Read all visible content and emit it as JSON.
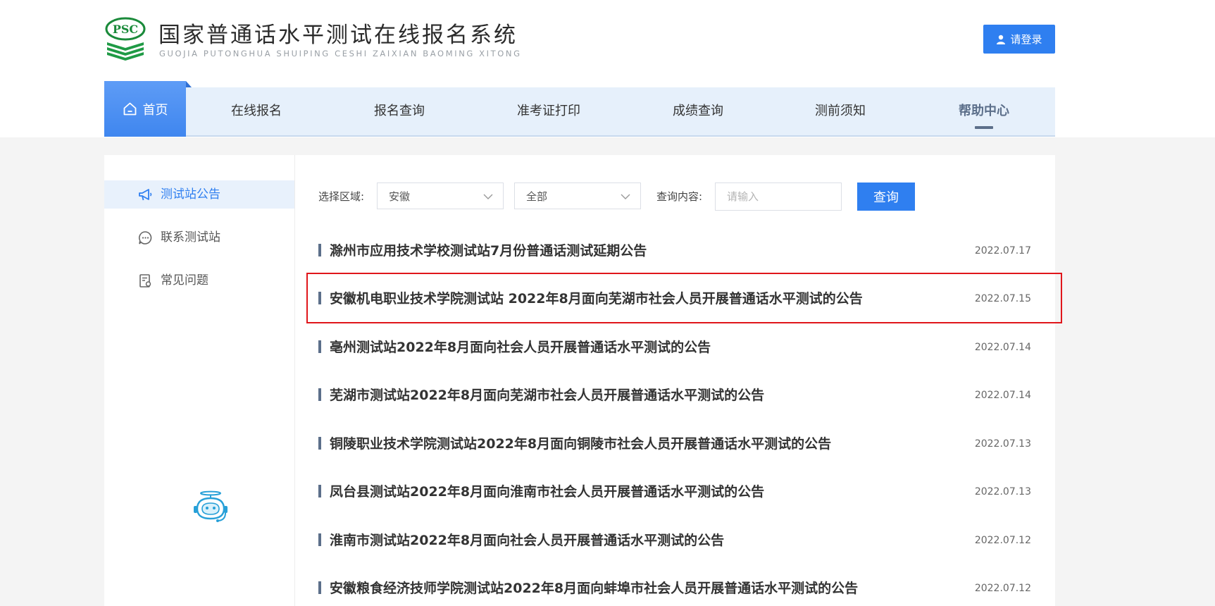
{
  "header": {
    "title": "国家普通话水平测试在线报名系统",
    "subtitle": "GUOJIA PUTONGHUA SHUIPING CESHI ZAIXIAN BAOMING XITONG",
    "logo_text": "PSC",
    "login_label": "请登录",
    "brand_color": "#2f7ff0"
  },
  "nav": {
    "home_label": "首页",
    "items": [
      {
        "label": "在线报名"
      },
      {
        "label": "报名查询"
      },
      {
        "label": "准考证打印"
      },
      {
        "label": "成绩查询"
      },
      {
        "label": "测前须知"
      },
      {
        "label": "帮助中心"
      }
    ],
    "active": "帮助中心"
  },
  "sidebar": {
    "items": [
      {
        "label": "测试站公告",
        "icon": "megaphone-icon",
        "active": true
      },
      {
        "label": "联系测试站",
        "icon": "chat-icon",
        "active": false
      },
      {
        "label": "常见问题",
        "icon": "document-icon",
        "active": false
      }
    ],
    "assistant_icon": "robot-icon"
  },
  "filters": {
    "region_label": "选择区域:",
    "region_value": "安徽",
    "scope_value": "全部",
    "query_label": "查询内容:",
    "query_placeholder": "请输入",
    "query_button": "查询"
  },
  "announcements": [
    {
      "title": "滁州市应用技术学校测试站7月份普通话测试延期公告",
      "date": "2022.07.17"
    },
    {
      "title": "安徽机电职业技术学院测试站 2022年8月面向芜湖市社会人员开展普通话水平测试的公告",
      "date": "2022.07.15",
      "highlighted": true
    },
    {
      "title": "亳州测试站2022年8月面向社会人员开展普通话水平测试的公告",
      "date": "2022.07.14"
    },
    {
      "title": "芜湖市测试站2022年8月面向芜湖市社会人员开展普通话水平测试的公告",
      "date": "2022.07.14"
    },
    {
      "title": "铜陵职业技术学院测试站2022年8月面向铜陵市社会人员开展普通话水平测试的公告",
      "date": "2022.07.13"
    },
    {
      "title": "凤台县测试站2022年8月面向淮南市社会人员开展普通话水平测试的公告",
      "date": "2022.07.13"
    },
    {
      "title": "淮南市测试站2022年8月面向社会人员开展普通话水平测试的公告",
      "date": "2022.07.12"
    },
    {
      "title": "安徽粮食经济技师学院测试站2022年8月面向蚌埠市社会人员开展普通话水平测试的公告",
      "date": "2022.07.12"
    }
  ],
  "colors": {
    "highlight_border": "#e0161b",
    "nav_background": "#e6f0fb",
    "accent_dark": "#5c6f8a"
  }
}
